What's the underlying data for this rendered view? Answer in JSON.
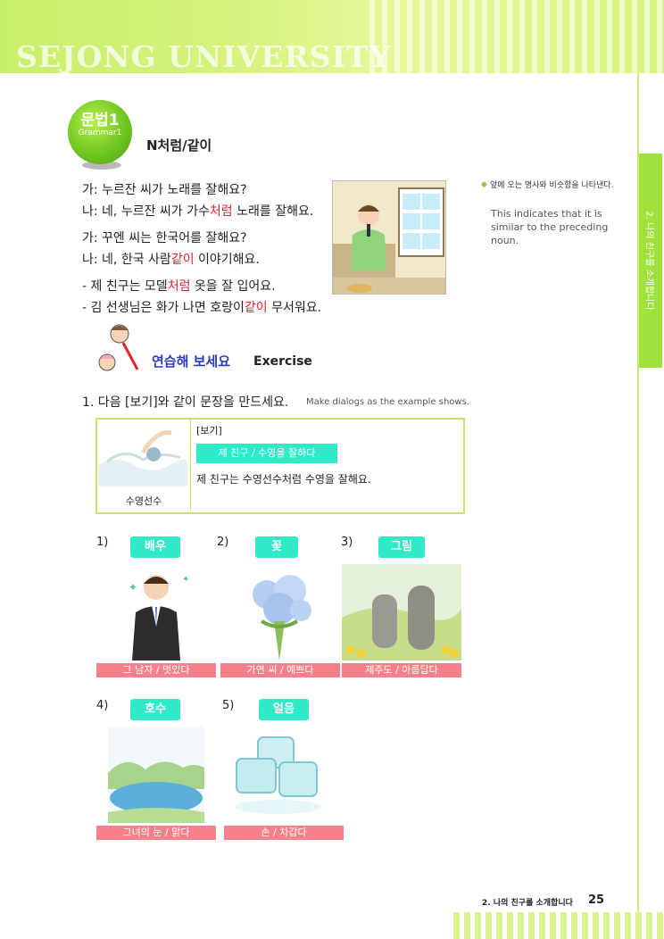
{
  "header": {
    "brand": "SEJONG UNIVERSITY"
  },
  "side_tab": {
    "text": "2. 나의 친구를 소개합니다"
  },
  "grammar": {
    "badge_main": "문법1",
    "badge_sub": "Grammar1",
    "title": "N처럼/같이"
  },
  "dialogs": [
    {
      "line1": "가: 누르잔 씨가 노래를 잘해요?",
      "line2_pre": "나: 네, 누르잔 씨가 가수",
      "line2_hl": "처럼",
      "line2_post": " 노래를 잘해요."
    },
    {
      "line1": "가: 꾸엔 씨는 한국어를 잘해요?",
      "line2_pre": "나: 네, 한국 사람",
      "line2_hl": "같이",
      "line2_post": " 이야기해요."
    }
  ],
  "examples": [
    {
      "pre": "- 제 친구는 모델",
      "hl": "처럼",
      "post": " 옷을 잘 입어요."
    },
    {
      "pre": "- 김 선생님은 화가 나면 호랑이",
      "hl": "같이",
      "post": " 무서워요."
    }
  ],
  "note": {
    "korean": "앞에 오는 명사와 비슷함을 나타낸다.",
    "english": "This indicates that it is similar to the preceding noun."
  },
  "exercise": {
    "title_kr": "연습해 보세요",
    "title_en": "Exercise",
    "q1": "1. 다음 [보기]와 같이 문장을 만드세요.",
    "q1_en": "Make dialogs as the example shows.",
    "example_caption": "수영선수",
    "example_label": "[보기]",
    "example_prompt": "제 친구 / 수영을 잘하다",
    "example_sentence": "제 친구는 수영선수처럼 수영을 잘해요."
  },
  "items": [
    {
      "number": "1)",
      "word": "배우",
      "caption": "그 남자 / 멋있다"
    },
    {
      "number": "2)",
      "word": "꽃",
      "caption": "가연 씨 / 예쁘다"
    },
    {
      "number": "3)",
      "word": "그림",
      "caption": "제주도 / 아름답다"
    },
    {
      "number": "4)",
      "word": "호수",
      "caption": "그녀의 눈 / 맑다"
    },
    {
      "number": "5)",
      "word": "얼음",
      "caption": "손 / 차갑다"
    }
  ],
  "footer": {
    "text": "2. 나의 친구를 소개합니다",
    "page": "25"
  }
}
